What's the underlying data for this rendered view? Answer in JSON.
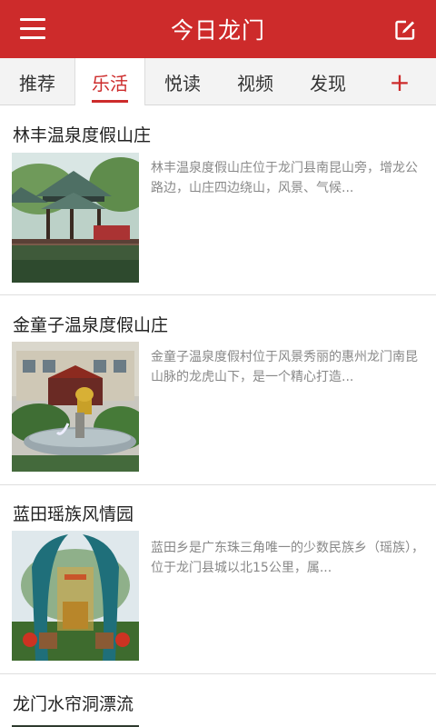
{
  "header": {
    "title": "今日龙门",
    "menu_icon": "hamburger-menu-icon",
    "edit_icon": "edit-icon"
  },
  "tabs": [
    {
      "label": "推荐",
      "active": false
    },
    {
      "label": "乐活",
      "active": true
    },
    {
      "label": "悦读",
      "active": false
    },
    {
      "label": "视频",
      "active": false
    },
    {
      "label": "发现",
      "active": false
    }
  ],
  "add_tab": {
    "label": "+"
  },
  "colors": {
    "brand": "#cd2b2b",
    "tab_bg": "#f3f3f3",
    "desc_text": "#888888"
  },
  "articles": [
    {
      "title": "林丰温泉度假山庄",
      "desc": "林丰温泉度假山庄位于龙门县南昆山旁，增龙公路边，山庄四边绕山，风景、气候..."
    },
    {
      "title": "金童子温泉度假山庄",
      "desc": "金童子温泉度假村位于风景秀丽的惠州龙门南昆山脉的龙虎山下，是一个精心打造..."
    },
    {
      "title": "蓝田瑶族风情园",
      "desc": "蓝田乡是广东珠三角唯一的少数民族乡（瑶族），位于龙门县城以北15公里，属..."
    },
    {
      "title": "龙门水帘洞漂流",
      "desc": ""
    }
  ]
}
